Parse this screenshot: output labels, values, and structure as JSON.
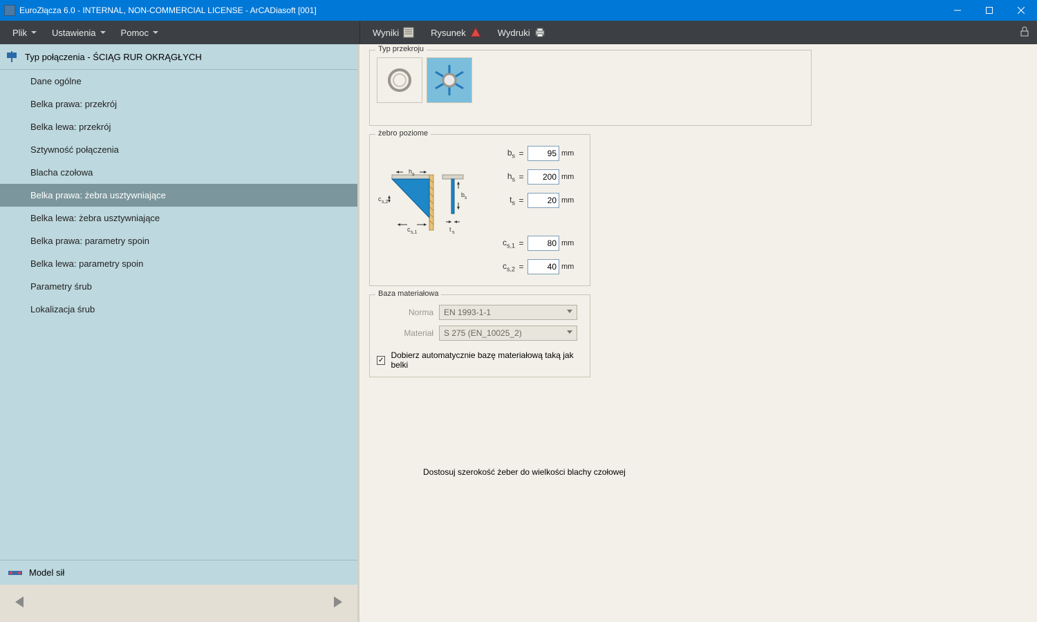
{
  "window": {
    "title": "EuroZłącza 6.0 - INTERNAL, NON-COMMERCIAL LICENSE - ArCADiasoft [001]"
  },
  "menubar_left": {
    "items": [
      {
        "label": "Plik"
      },
      {
        "label": "Ustawienia"
      },
      {
        "label": "Pomoc"
      }
    ]
  },
  "menubar_right": {
    "items": [
      {
        "label": "Wyniki"
      },
      {
        "label": "Rysunek"
      },
      {
        "label": "Wydruki"
      }
    ]
  },
  "sidebar": {
    "header": "Typ połączenia - ŚCIĄG RUR OKRĄGŁYCH",
    "items": [
      {
        "label": "Dane ogólne"
      },
      {
        "label": "Belka prawa: przekrój"
      },
      {
        "label": "Belka lewa: przekrój"
      },
      {
        "label": "Sztywność połączenia"
      },
      {
        "label": "Blacha czołowa"
      },
      {
        "label": "Belka prawa: żebra usztywniające"
      },
      {
        "label": "Belka lewa: żebra usztywniające"
      },
      {
        "label": "Belka prawa: parametry spoin"
      },
      {
        "label": "Belka lewa: parametry spoin"
      },
      {
        "label": "Parametry śrub"
      },
      {
        "label": "Lokalizacja śrub"
      }
    ],
    "active_index": 5,
    "group": "Model sił"
  },
  "content": {
    "typ_przekroju_legend": "Typ przekroju",
    "zebro_legend": "żebro poziome",
    "fields": {
      "bs": "95",
      "hs": "200",
      "ts": "20",
      "cs1": "80",
      "cs2": "40",
      "unit": "mm"
    },
    "diagram_labels": {
      "hs_top": "h",
      "bs_right": "b",
      "cs2_left": "c",
      "cs1_bottom": "c",
      "ts_bottom": "t"
    },
    "baza_legend": "Baza materiałowa",
    "norma_label": "Norma",
    "norma_value": "EN 1993-1-1",
    "material_label": "Materiał",
    "material_value": "S 275 (EN_10025_2)",
    "auto_check_label": "Dobierz automatycznie bazę materiałową taką jak belki",
    "bottom_check_label": "Dostosuj szerokość żeber do wielkości blachy czołowej"
  }
}
